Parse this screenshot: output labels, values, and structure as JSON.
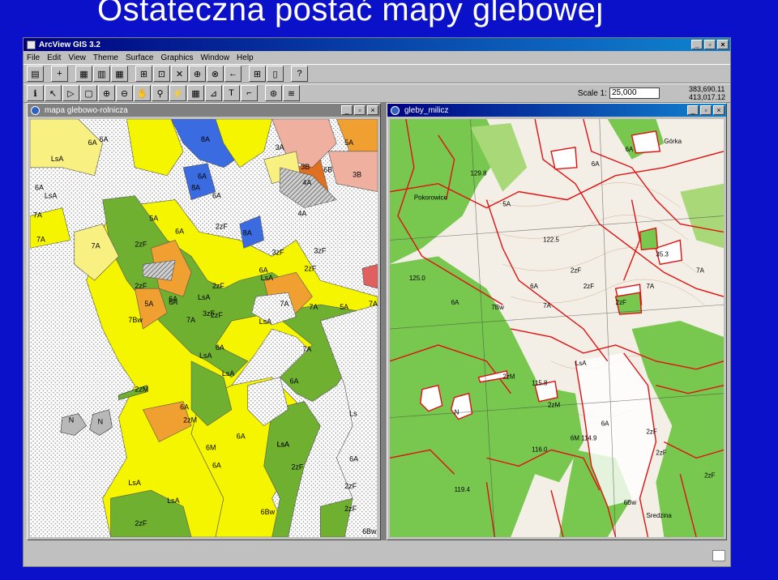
{
  "slide": {
    "title": "Ostateczna postać mapy glebowej"
  },
  "app": {
    "title": "ArcView GIS 3.2",
    "win_min": "_",
    "win_max": "▫",
    "win_close": "×",
    "menu": [
      "File",
      "Edit",
      "View",
      "Theme",
      "Surface",
      "Graphics",
      "Window",
      "Help"
    ],
    "toolbar1": [
      "save-icon",
      "add-theme-icon",
      "theme-properties-icon",
      "legend-editor-icon",
      "table-icon",
      "zoom-full-icon",
      "zoom-active-icon",
      "zoom-selected-icon",
      "zoom-in-icon",
      "zoom-out-icon",
      "zoom-previous-icon",
      "select-features-icon",
      "clear-selection-icon",
      "layout-icon",
      "help-icon"
    ],
    "toolbar2": [
      "identify-icon",
      "pointer-icon",
      "vertex-edit-icon",
      "select-feature-icon",
      "zoom-in-tool-icon",
      "zoom-out-tool-icon",
      "pan-icon",
      "measure-icon",
      "hotlink-icon",
      "area-of-interest-icon",
      "label-icon",
      "text-icon",
      "draw-icon",
      "snap-icon",
      "contour-icon"
    ],
    "scale_label": "Scale 1:",
    "scale_value": "25,000",
    "coord_x": "383,690.11",
    "coord_y": "413,017.12"
  },
  "windows": {
    "left": {
      "title": "mapa glebowo-rolnicza"
    },
    "right": {
      "title": "gleby_milicz"
    }
  },
  "colors": {
    "blue": "#0b11c8",
    "soil_yellow": "#f5f500",
    "soil_orange": "#f0a030",
    "soil_green": "#70b030",
    "soil_blue": "#3a6be0",
    "soil_pink": "#f0b0a0",
    "soil_lightyellow": "#f8f080",
    "forest": "#78c850",
    "boundary": "#e01010"
  },
  "left_labels": [
    "6A",
    "8A",
    "6A",
    "3A",
    "5A",
    "3B",
    "6B",
    "3B",
    "LsA",
    "6A",
    "4A",
    "8A",
    "6A",
    "6A",
    "LsA",
    "7A",
    "4A",
    "2zF",
    "6A",
    "5A",
    "7A",
    "2zF",
    "8A",
    "3zF",
    "7A",
    "3zF",
    "2zF",
    "2zF",
    "6A",
    "2zF",
    "6A",
    "LsA",
    "LsA",
    "7A",
    "6A",
    "5A",
    "2zF",
    "LsA",
    "7A",
    "7A",
    "5A",
    "7A",
    "7Bw",
    "3zF",
    "7A",
    "6A",
    "6A",
    "LsA",
    "LsA",
    "6A",
    "2zM",
    "2zM",
    "N",
    "N",
    "Ls",
    "6A",
    "6M",
    "LsA",
    "6A",
    "2zF",
    "LsA",
    "6A",
    "LsA",
    "2zF",
    "2zF",
    "6Bw",
    "2zF",
    "6Bw",
    "LsA"
  ],
  "right_labels": [
    "6A",
    "Górka",
    "129.8",
    "Pokorowice",
    "122.5",
    "5A",
    "6A",
    "35.3",
    "125.0",
    "7A",
    "2zF",
    "6A",
    "7A",
    "2zF",
    "7A",
    "2zF",
    "7Bw",
    "6A",
    "LsA",
    "2zM",
    "115.8",
    "2zM",
    "N",
    "6A",
    "2zF",
    "6M 114.9",
    "116.0",
    "2zF",
    "119.4",
    "6Bw",
    "Sredzina",
    "2zF"
  ]
}
